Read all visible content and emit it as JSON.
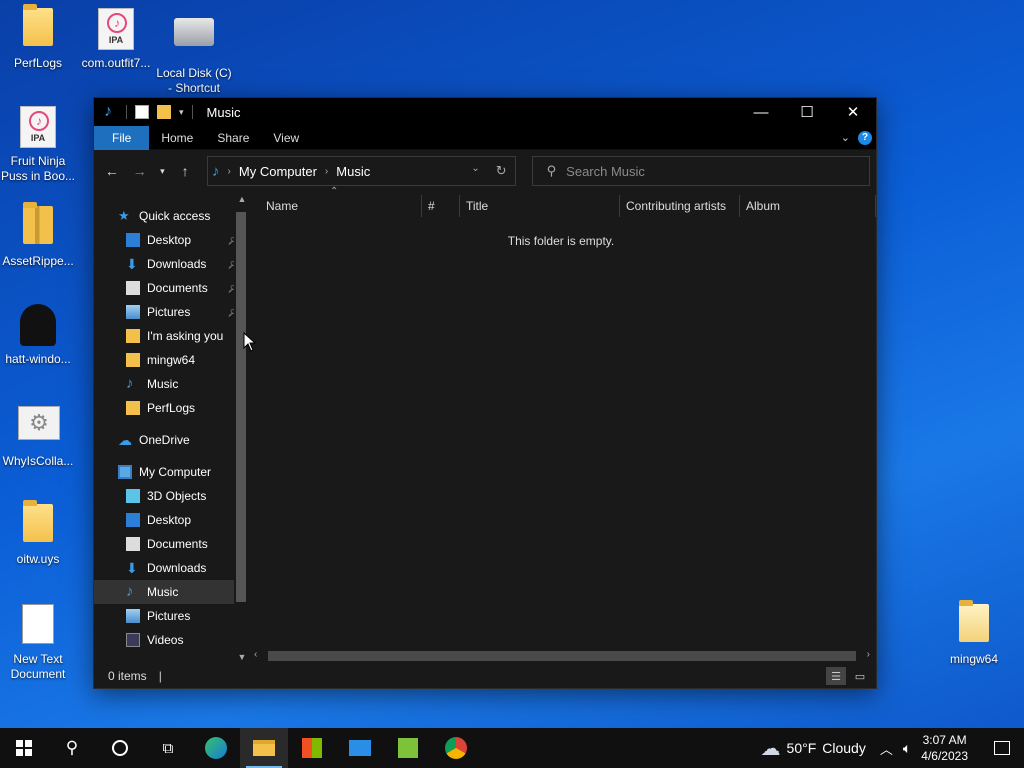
{
  "desktop": {
    "icons": [
      {
        "label": "PerfLogs"
      },
      {
        "label": "com.outfit7..."
      },
      {
        "label": "Local Disk (C)\n- Shortcut"
      },
      {
        "label": "Fruit Ninja\nPuss in Boo..."
      },
      {
        "label": "AssetRippe..."
      },
      {
        "label": "hatt-windo..."
      },
      {
        "label": "WhyIsColla..."
      },
      {
        "label": "oitw.uys"
      },
      {
        "label": "New Text\nDocument"
      },
      {
        "label": "mingw64"
      }
    ],
    "ipa_text": "IPA"
  },
  "window": {
    "title": "Music",
    "ribbon_tabs": [
      "File",
      "Home",
      "Share",
      "View"
    ],
    "address": {
      "segments": [
        "My Computer",
        "Music"
      ]
    },
    "search": {
      "placeholder": "Search Music"
    },
    "nav": {
      "quick_access": "Quick access",
      "quick_items": [
        "Desktop",
        "Downloads",
        "Documents",
        "Pictures",
        "I'm  asking you",
        "mingw64",
        "Music",
        "PerfLogs"
      ],
      "onedrive": "OneDrive",
      "computer": "My Computer",
      "computer_items": [
        "3D Objects",
        "Desktop",
        "Documents",
        "Downloads",
        "Music",
        "Pictures",
        "Videos"
      ]
    },
    "columns": [
      "Name",
      "#",
      "Title",
      "Contributing artists",
      "Album"
    ],
    "empty_message": "This folder is empty.",
    "status": {
      "items": "0 items"
    }
  },
  "taskbar": {
    "weather": {
      "temp": "50°F",
      "condition": "Cloudy"
    },
    "clock": {
      "time": "3:07 AM",
      "date": "4/6/2023"
    }
  },
  "colors": {
    "accent": "#1f6fbf",
    "window_bg": "#191919",
    "taskbar_bg": "#101010"
  }
}
